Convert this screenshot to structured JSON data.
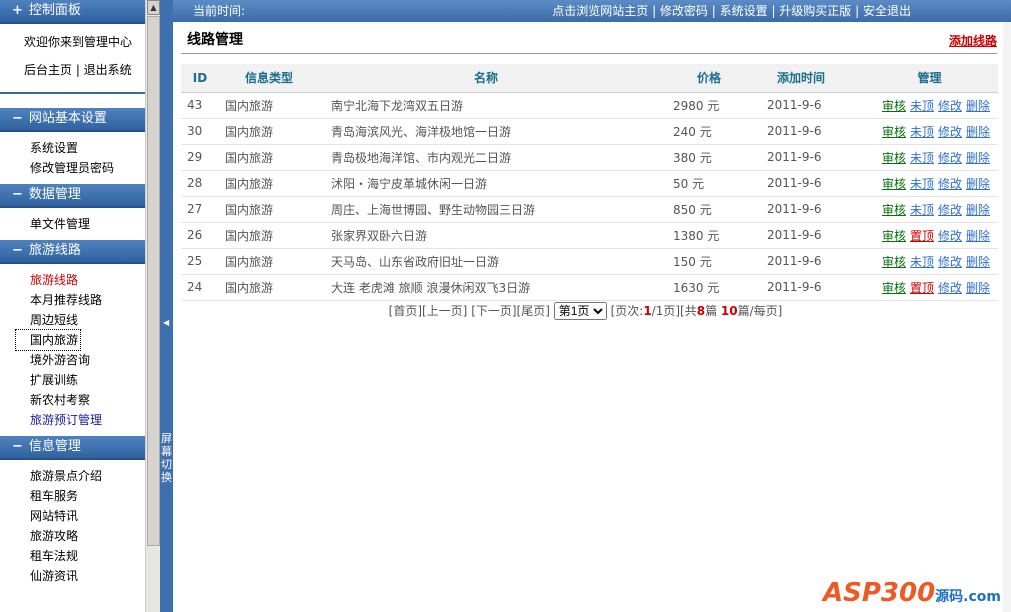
{
  "sidebar": {
    "control_panel": "控制面板",
    "welcome": "欢迎你来到管理中心",
    "home_logout": "后台主页 | 退出系统",
    "sections": [
      {
        "title": "网站基本设置",
        "items": [
          "系统设置",
          "修改管理员密码"
        ]
      },
      {
        "title": "数据管理",
        "items": [
          "单文件管理"
        ]
      },
      {
        "title": "旅游线路",
        "items": [
          "旅游线路",
          "本月推荐线路",
          "周边短线",
          "国内旅游",
          "境外游咨询",
          "扩展训练",
          "新农村考察",
          "旅游预订管理"
        ]
      },
      {
        "title": "信息管理",
        "items": [
          "旅游景点介绍",
          "租车服务",
          "网站特讯",
          "旅游攻略",
          "租车法规",
          "仙游资讯"
        ]
      }
    ]
  },
  "toggle": {
    "label": "屏幕切换"
  },
  "topbar": {
    "time_label": "当前时间:",
    "links": [
      "点击浏览网站主页",
      "修改密码",
      "系统设置",
      "升级购买正版",
      "安全退出"
    ]
  },
  "page": {
    "title": "线路管理",
    "add_label": "添加线路"
  },
  "table": {
    "headers": [
      "ID",
      "信息类型",
      "名称",
      "价格",
      "添加时间",
      "管理"
    ],
    "rows": [
      {
        "id": "43",
        "type": "国内旅游",
        "name": "南宁北海下龙湾双五日游",
        "price": "2980 元",
        "date": "2011-9-6",
        "top": "未顶"
      },
      {
        "id": "30",
        "type": "国内旅游",
        "name": "青岛海滨风光、海洋极地馆一日游",
        "price": "240 元",
        "date": "2011-9-6",
        "top": "未顶"
      },
      {
        "id": "29",
        "type": "国内旅游",
        "name": "青岛极地海洋馆、市内观光二日游",
        "price": "380 元",
        "date": "2011-9-6",
        "top": "未顶"
      },
      {
        "id": "28",
        "type": "国内旅游",
        "name": "沭阳・海宁皮革城休闲一日游",
        "price": "50 元",
        "date": "2011-9-6",
        "top": "未顶"
      },
      {
        "id": "27",
        "type": "国内旅游",
        "name": "周庄、上海世博园、野生动物园三日游",
        "price": "850 元",
        "date": "2011-9-6",
        "top": "未顶"
      },
      {
        "id": "26",
        "type": "国内旅游",
        "name": "张家界双卧六日游",
        "price": "1380 元",
        "date": "2011-9-6",
        "top": "置顶"
      },
      {
        "id": "25",
        "type": "国内旅游",
        "name": "天马岛、山东省政府旧址一日游",
        "price": "150 元",
        "date": "2011-9-6",
        "top": "未顶"
      },
      {
        "id": "24",
        "type": "国内旅游",
        "name": "大连 老虎滩 旅顺 浪漫休闲双飞3日游",
        "price": "1630 元",
        "date": "2011-9-6",
        "top": "置顶"
      }
    ],
    "ops": {
      "audit": "审核",
      "edit": "修改",
      "delete": "删除"
    }
  },
  "pager": {
    "first_prev": "[首页][上一页]",
    "next_last": " [下一页][尾页]",
    "select": "第1页",
    "pages_pre": " [页次:",
    "page_cur": "1",
    "pages_mid": "/1页][共",
    "total": "8",
    "total_suffix": "篇  ",
    "per": "10",
    "per_suffix": "篇/每页]"
  },
  "logo": {
    "text": "ASP300",
    "sub": "源码.com"
  },
  "colors": {
    "accent": "#3e6fae",
    "red": "#cc0000",
    "green": "#06710b",
    "link": "#2f6fd0"
  }
}
